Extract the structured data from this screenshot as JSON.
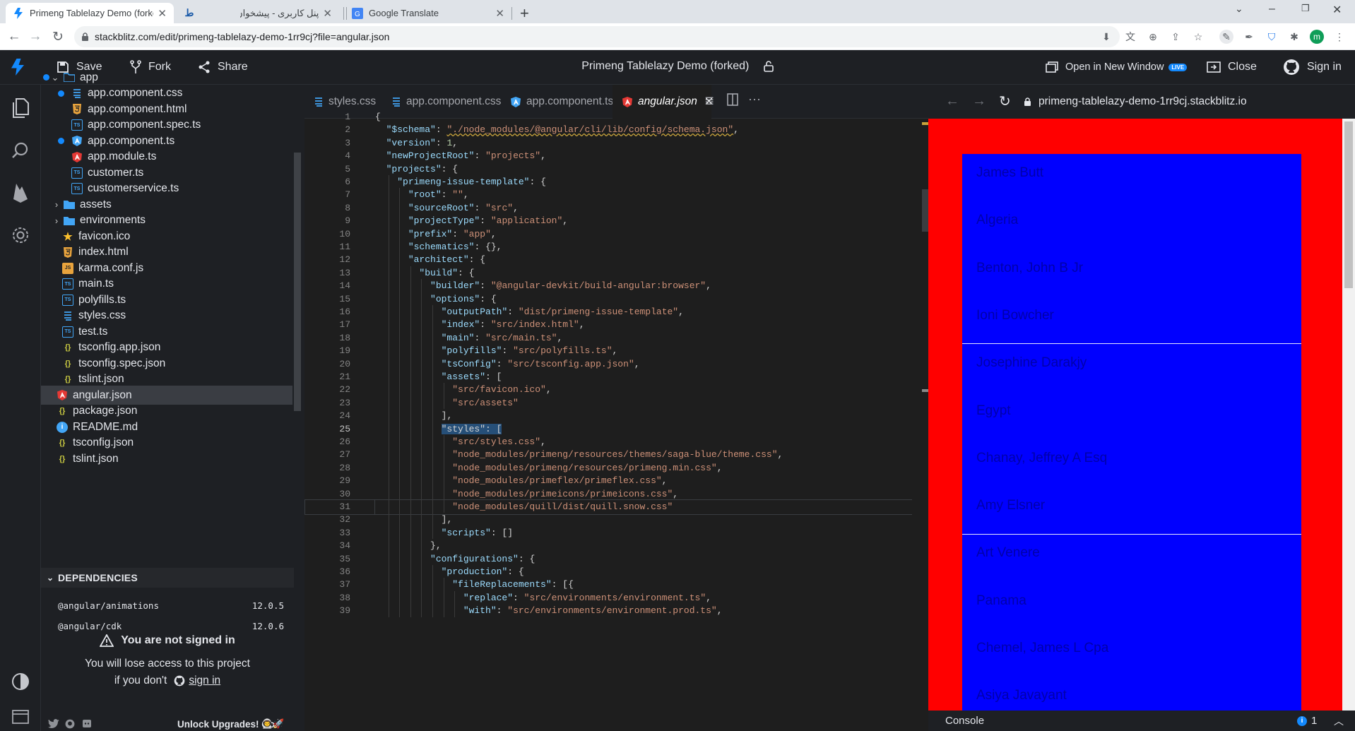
{
  "browser": {
    "tabs": [
      {
        "title": "Primeng Tablelazy Demo (forked)",
        "active": true
      },
      {
        "title": "",
        "active": false
      },
      {
        "title": "پنل کاربری - پیشخوان",
        "active": false
      },
      {
        "title": "Google Translate",
        "active": false
      }
    ],
    "url": "stackblitz.com/edit/primeng-tablelazy-demo-1rr9cj?file=angular.json",
    "profile_initial": "m"
  },
  "header": {
    "save_label": "Save",
    "fork_label": "Fork",
    "share_label": "Share",
    "project_title": "Primeng Tablelazy Demo (forked)",
    "open_new_window_label": "Open in New Window",
    "live_badge": "LIVE",
    "close_label": "Close",
    "sign_in_label": "Sign in"
  },
  "explorer": {
    "items": [
      {
        "name": "app",
        "type": "folder-open",
        "indent": 1,
        "dot": true
      },
      {
        "name": "app.component.css",
        "type": "css",
        "indent": 3,
        "dot": true
      },
      {
        "name": "app.component.html",
        "type": "html",
        "indent": 3
      },
      {
        "name": "app.component.spec.ts",
        "type": "ts",
        "indent": 3
      },
      {
        "name": "app.component.ts",
        "type": "angular-blue",
        "indent": 3,
        "dot": true
      },
      {
        "name": "app.module.ts",
        "type": "angular",
        "indent": 3
      },
      {
        "name": "customer.ts",
        "type": "ts",
        "indent": 3
      },
      {
        "name": "customerservice.ts",
        "type": "ts",
        "indent": 3
      },
      {
        "name": "assets",
        "type": "folder",
        "indent": 2
      },
      {
        "name": "environments",
        "type": "folder",
        "indent": 2
      },
      {
        "name": "favicon.ico",
        "type": "star",
        "indent": 2
      },
      {
        "name": "index.html",
        "type": "html",
        "indent": 2
      },
      {
        "name": "karma.conf.js",
        "type": "js",
        "indent": 2
      },
      {
        "name": "main.ts",
        "type": "ts",
        "indent": 2
      },
      {
        "name": "polyfills.ts",
        "type": "ts",
        "indent": 2
      },
      {
        "name": "styles.css",
        "type": "css",
        "indent": 2
      },
      {
        "name": "test.ts",
        "type": "ts",
        "indent": 2
      },
      {
        "name": "tsconfig.app.json",
        "type": "json",
        "indent": 2
      },
      {
        "name": "tsconfig.spec.json",
        "type": "json",
        "indent": 2
      },
      {
        "name": "tslint.json",
        "type": "json",
        "indent": 2
      },
      {
        "name": "angular.json",
        "type": "angular",
        "indent": 1,
        "selected": true
      },
      {
        "name": "package.json",
        "type": "json",
        "indent": 1
      },
      {
        "name": "README.md",
        "type": "info",
        "indent": 1
      },
      {
        "name": "tsconfig.json",
        "type": "json",
        "indent": 1
      },
      {
        "name": "tslint.json",
        "type": "json",
        "indent": 1
      }
    ],
    "dependencies_title": "DEPENDENCIES",
    "dependencies": [
      {
        "name": "@angular/animations",
        "version": "12.0.5"
      },
      {
        "name": "@angular/cdk",
        "version": "12.0.6"
      }
    ],
    "warning_title": "You are not signed in",
    "warning_line1": "You will lose access to this project",
    "warning_line2_prefix": "if you don't",
    "warning_link": "sign in",
    "unlock_label": "Unlock Upgrades! Go"
  },
  "editor": {
    "tabs": [
      {
        "name": "styles.css",
        "icon": "css",
        "modified": false
      },
      {
        "name": "app.component.css",
        "icon": "css",
        "modified": true
      },
      {
        "name": "app.component.ts",
        "icon": "angular-blue",
        "modified": true
      },
      {
        "name": "angular.json",
        "icon": "angular",
        "active": true
      }
    ],
    "lines": [
      "{",
      "  \"$schema\": \"./node_modules/@angular/cli/lib/config/schema.json\",",
      "  \"version\": 1,",
      "  \"newProjectRoot\": \"projects\",",
      "  \"projects\": {",
      "    \"primeng-issue-template\": {",
      "      \"root\": \"\",",
      "      \"sourceRoot\": \"src\",",
      "      \"projectType\": \"application\",",
      "      \"prefix\": \"app\",",
      "      \"schematics\": {},",
      "      \"architect\": {",
      "        \"build\": {",
      "          \"builder\": \"@angular-devkit/build-angular:browser\",",
      "          \"options\": {",
      "            \"outputPath\": \"dist/primeng-issue-template\",",
      "            \"index\": \"src/index.html\",",
      "            \"main\": \"src/main.ts\",",
      "            \"polyfills\": \"src/polyfills.ts\",",
      "            \"tsConfig\": \"src/tsconfig.app.json\",",
      "            \"assets\": [",
      "              \"src/favicon.ico\",",
      "              \"src/assets\"",
      "            ],",
      "            \"styles\": [",
      "              \"src/styles.css\",",
      "              \"node_modules/primeng/resources/themes/saga-blue/theme.css\",",
      "              \"node_modules/primeng/resources/primeng.min.css\",",
      "              \"node_modules/primeflex/primeflex.css\",",
      "              \"node_modules/primeicons/primeicons.css\",",
      "              \"node_modules/quill/dist/quill.snow.css\"",
      "            ],",
      "            \"scripts\": []",
      "          },",
      "          \"configurations\": {",
      "            \"production\": {",
      "              \"fileReplacements\": [{",
      "                \"replace\": \"src/environments/environment.ts\",",
      "                \"with\": \"src/environments/environment.prod.ts\","
    ],
    "current_line": 25
  },
  "preview": {
    "url": "primeng-tablelazy-demo-1rr9cj.stackblitz.io",
    "rows": [
      "James Butt",
      "Algeria",
      "Benton, John B Jr",
      "Ioni Bowcher",
      "Josephine Darakjy",
      "Egypt",
      "Chanay, Jeffrey A Esq",
      "Amy Elsner",
      "Art Venere",
      "Panama",
      "Chemel, James L Cpa",
      "Asiya Javayant"
    ],
    "console_label": "Console",
    "console_count": "1"
  },
  "colors": {
    "preview_bg": "#ff0000",
    "preview_box": "#0000ff",
    "accent": "#1389fd"
  }
}
